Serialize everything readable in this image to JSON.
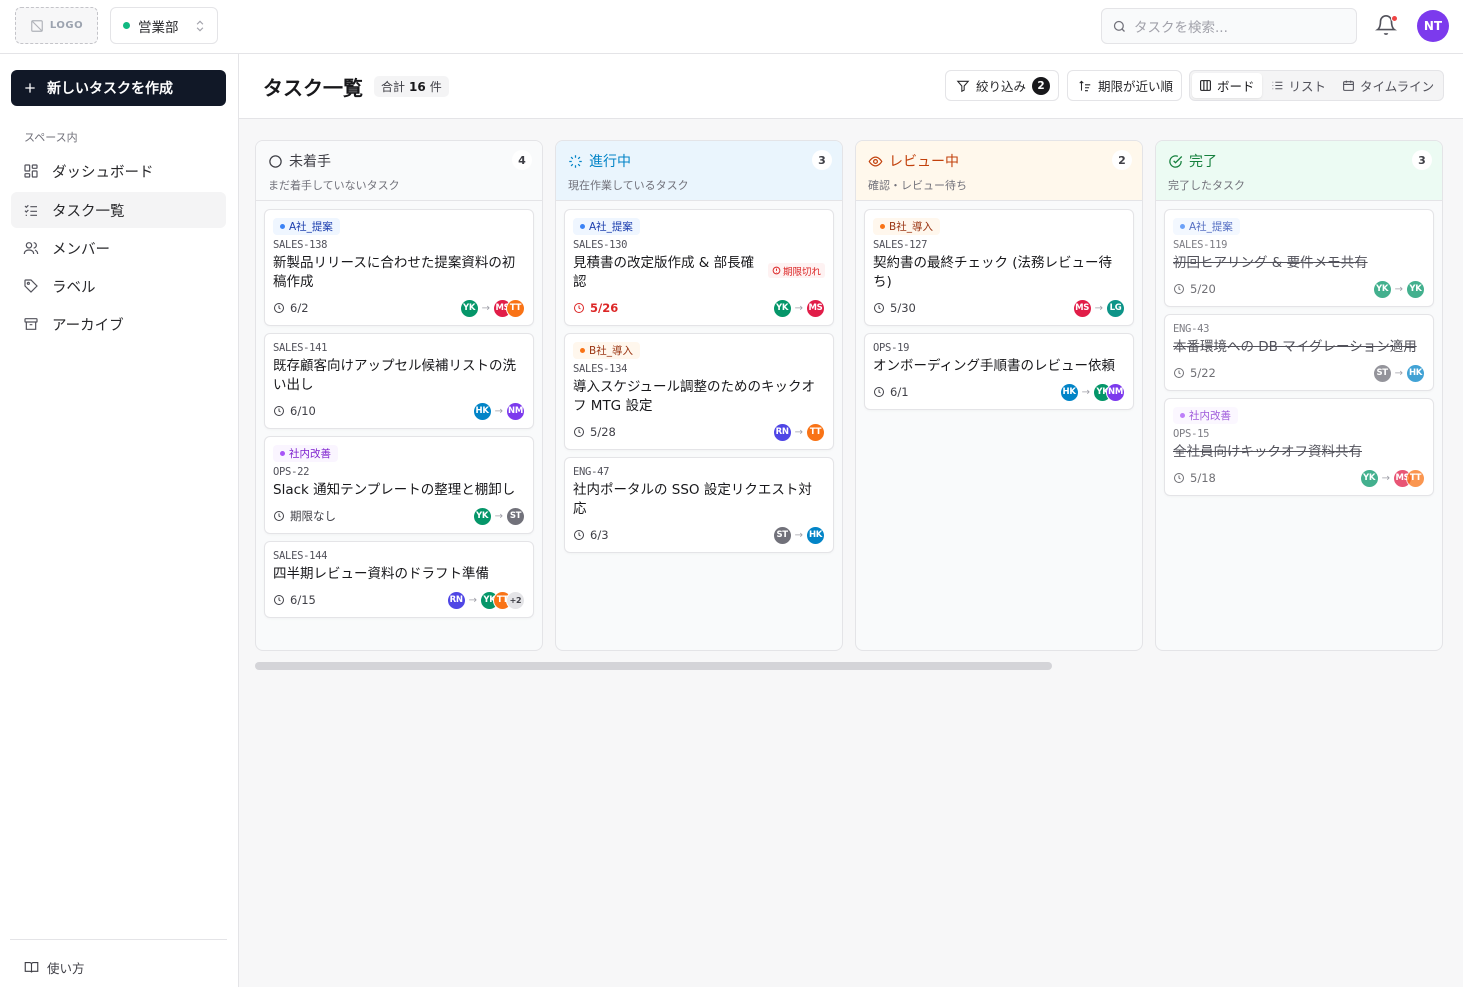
{
  "topbar": {
    "logo_text": "LOGO",
    "workspace": "営業部",
    "search_placeholder": "タスクを検索...",
    "user_initials": "NT"
  },
  "sidebar": {
    "new_task": "新しいタスクを作成",
    "section": "スペース内",
    "items": [
      {
        "label": "ダッシュボード",
        "icon": "dashboard-icon"
      },
      {
        "label": "タスク一覧",
        "icon": "checklist-icon",
        "active": true
      },
      {
        "label": "メンバー",
        "icon": "users-icon"
      },
      {
        "label": "ラベル",
        "icon": "tag-icon"
      },
      {
        "label": "アーカイブ",
        "icon": "archive-icon"
      }
    ],
    "help": "使い方"
  },
  "header": {
    "title": "タスク一覧",
    "count_prefix": "合計",
    "count_value": "16",
    "count_suffix": "件",
    "filter_label": "絞り込み",
    "filter_count": "2",
    "sort_label": "期限が近い順",
    "views": [
      "ボード",
      "リスト",
      "タイムライン"
    ],
    "active_view": "ボード"
  },
  "colors": {
    "todo": "#3f3f46",
    "progress": "#0284c7",
    "review": "#c2410c",
    "done": "#15803d"
  },
  "columns": [
    {
      "key": "todo",
      "title": "未着手",
      "subtitle": "まだ着手していないタスク",
      "count": "4",
      "cards": [
        {
          "tag": "A社_提案",
          "tag_color": "blue",
          "id": "SALES-138",
          "title": "新製品リリースに合わせた提案資料の初稿作成",
          "due": "6/2",
          "from": [
            [
              "YK",
              "#059669"
            ]
          ],
          "to": [
            [
              "MS",
              "#e11d48"
            ],
            [
              "TT",
              "#f97316"
            ]
          ]
        },
        {
          "tag": "",
          "id": "SALES-141",
          "title": "既存顧客向けアップセル候補リストの洗い出し",
          "due": "6/10",
          "from": [
            [
              "HK",
              "#0284c7"
            ]
          ],
          "to": [
            [
              "NM",
              "#7c3aed"
            ]
          ]
        },
        {
          "tag": "社内改善",
          "tag_color": "purple",
          "id": "OPS-22",
          "title": "Slack 通知テンプレートの整理と棚卸し",
          "due": "期限なし",
          "from": [
            [
              "YK",
              "#059669"
            ]
          ],
          "to": [
            [
              "ST",
              "#71717a"
            ]
          ]
        },
        {
          "tag": "",
          "id": "SALES-144",
          "title": "四半期レビュー資料のドラフト準備",
          "due": "6/15",
          "from": [
            [
              "RN",
              "#4f46e5"
            ]
          ],
          "to": [
            [
              "YK",
              "#059669"
            ],
            [
              "TT",
              "#f97316"
            ]
          ],
          "more": "+2"
        }
      ]
    },
    {
      "key": "progress",
      "title": "進行中",
      "subtitle": "現在作業しているタスク",
      "count": "3",
      "cards": [
        {
          "tag": "A社_提案",
          "tag_color": "blue",
          "id": "SALES-130",
          "title": "見積書の改定版作成 & 部長確認",
          "due": "5/26",
          "due_red": true,
          "overdue": "期限切れ",
          "from": [
            [
              "YK",
              "#059669"
            ]
          ],
          "to": [
            [
              "MS",
              "#e11d48"
            ]
          ]
        },
        {
          "tag": "B社_導入",
          "tag_color": "orange",
          "id": "SALES-134",
          "title": "導入スケジュール調整のためのキックオフ MTG 設定",
          "due": "5/28",
          "from": [
            [
              "RN",
              "#4f46e5"
            ]
          ],
          "to": [
            [
              "TT",
              "#f97316"
            ]
          ]
        },
        {
          "tag": "",
          "id": "ENG-47",
          "title": "社内ポータルの SSO 設定リクエスト対応",
          "due": "6/3",
          "from": [
            [
              "ST",
              "#71717a"
            ]
          ],
          "to": [
            [
              "HK",
              "#0284c7"
            ]
          ]
        }
      ]
    },
    {
      "key": "review",
      "title": "レビュー中",
      "subtitle": "確認・レビュー待ち",
      "count": "2",
      "cards": [
        {
          "tag": "B社_導入",
          "tag_color": "orange",
          "id": "SALES-127",
          "title": "契約書の最終チェック (法務レビュー待ち)",
          "due": "5/30",
          "from": [
            [
              "MS",
              "#e11d48"
            ]
          ],
          "to": [
            [
              "LG",
              "#0d9488"
            ]
          ]
        },
        {
          "tag": "",
          "id": "OPS-19",
          "title": "オンボーディング手順書のレビュー依頼",
          "due": "6/1",
          "from": [
            [
              "HK",
              "#0284c7"
            ]
          ],
          "to": [
            [
              "YK",
              "#059669"
            ],
            [
              "NM",
              "#7c3aed"
            ]
          ]
        }
      ]
    },
    {
      "key": "done",
      "title": "完了",
      "subtitle": "完了したタスク",
      "count": "3",
      "cards": [
        {
          "tag": "A社_提案",
          "tag_color": "blue",
          "id": "SALES-119",
          "title": "初回ヒアリング & 要件メモ共有",
          "due": "5/20",
          "from": [
            [
              "YK",
              "#059669"
            ]
          ],
          "to": [
            [
              "YK",
              "#059669"
            ]
          ]
        },
        {
          "tag": "",
          "id": "ENG-43",
          "title": "本番環境への DB マイグレーション適用",
          "due": "5/22",
          "from": [
            [
              "ST",
              "#71717a"
            ]
          ],
          "to": [
            [
              "HK",
              "#0284c7"
            ]
          ]
        },
        {
          "tag": "社内改善",
          "tag_color": "purple",
          "id": "OPS-15",
          "title": "全社員向けキックオフ資料共有",
          "due": "5/18",
          "from": [
            [
              "YK",
              "#059669"
            ]
          ],
          "to": [
            [
              "MS",
              "#e11d48"
            ],
            [
              "TT",
              "#f97316"
            ]
          ]
        }
      ]
    }
  ]
}
